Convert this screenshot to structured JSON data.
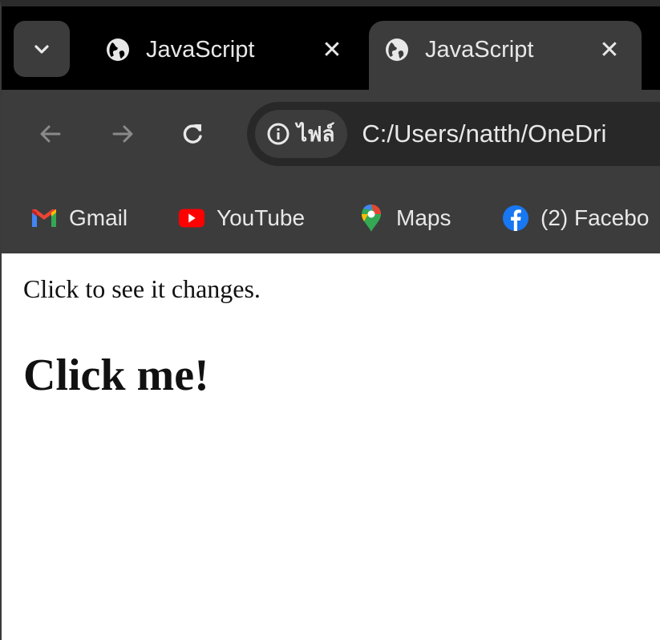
{
  "browser": {
    "tabs": [
      {
        "title": "JavaScript",
        "active": false
      },
      {
        "title": "JavaScript",
        "active": true
      }
    ],
    "address": {
      "site_chip": "ไฟล์",
      "url": "C:/Users/natth/OneDri"
    },
    "bookmarks": [
      {
        "label": "Gmail",
        "icon": "gmail-icon"
      },
      {
        "label": "YouTube",
        "icon": "youtube-icon"
      },
      {
        "label": "Maps",
        "icon": "maps-icon"
      },
      {
        "label": "(2) Facebo",
        "icon": "facebook-icon"
      }
    ]
  },
  "page": {
    "paragraph": "Click to see it changes.",
    "heading": "Click me!"
  },
  "colors": {
    "tabstrip": "#000000",
    "toolbar": "#3c3c3c",
    "omnibox": "#282828",
    "text_light": "#e8e8e8"
  }
}
